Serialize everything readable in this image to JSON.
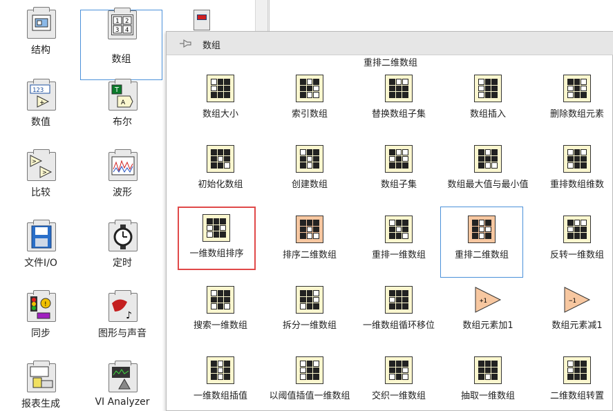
{
  "left_palette": {
    "items": [
      {
        "label": "结构",
        "icon": "structure-icon"
      },
      {
        "label": "数组",
        "icon": "array-icon",
        "glyph": "8 1 2\n3 4"
      },
      {
        "label": "数值",
        "icon": "numeric-icon",
        "glyph": "123"
      },
      {
        "label": "布尔",
        "icon": "boolean-icon",
        "glyph": "T"
      },
      {
        "label": "比较",
        "icon": "comparison-icon"
      },
      {
        "label": "波形",
        "icon": "waveform-icon"
      },
      {
        "label": "文件I/O",
        "icon": "file-io-icon"
      },
      {
        "label": "定时",
        "icon": "timing-icon"
      },
      {
        "label": "同步",
        "icon": "synchronization-icon"
      },
      {
        "label": "图形与声音",
        "icon": "graphics-sound-icon"
      },
      {
        "label": "报表生成",
        "icon": "report-generation-icon"
      },
      {
        "label": "VI Analyzer",
        "icon": "vi-analyzer-icon"
      }
    ]
  },
  "subpalette": {
    "title": "数组",
    "pin_icon": "pin-icon",
    "row0_label": "重排二维数组",
    "items": [
      {
        "label": "数组大小",
        "icon": "array-size-icon"
      },
      {
        "label": "索引数组",
        "icon": "index-array-icon"
      },
      {
        "label": "替换数组子集",
        "icon": "replace-array-subset-icon"
      },
      {
        "label": "数组插入",
        "icon": "insert-into-array-icon"
      },
      {
        "label": "删除数组元素",
        "icon": "delete-from-array-icon"
      },
      {
        "label": "初始化数组",
        "icon": "initialize-array-icon"
      },
      {
        "label": "创建数组",
        "icon": "build-array-icon"
      },
      {
        "label": "数组子集",
        "icon": "array-subset-icon"
      },
      {
        "label": "数组最大值与最小值",
        "icon": "array-max-min-icon"
      },
      {
        "label": "重排数组维数",
        "icon": "reshape-array-icon"
      },
      {
        "label": "一维数组排序",
        "icon": "sort-1d-array-icon"
      },
      {
        "label": "排序二维数组",
        "icon": "sort-2d-array-icon"
      },
      {
        "label": "重排一维数组",
        "icon": "shuffle-1d-array-icon"
      },
      {
        "label": "重排二维数组",
        "icon": "shuffle-2d-array-icon"
      },
      {
        "label": "反转一维数组",
        "icon": "reverse-1d-array-icon"
      },
      {
        "label": "搜索一维数组",
        "icon": "search-1d-array-icon"
      },
      {
        "label": "拆分一维数组",
        "icon": "split-1d-array-icon"
      },
      {
        "label": "一维数组循环移位",
        "icon": "rotate-1d-array-icon"
      },
      {
        "label": "数组元素加1",
        "icon": "increment-array-element-icon"
      },
      {
        "label": "数组元素减1",
        "icon": "decrement-array-element-icon"
      },
      {
        "label": "一维数组插值",
        "icon": "interpolate-1d-array-icon"
      },
      {
        "label": "以阈值插值一维数组",
        "icon": "threshold-1d-array-icon"
      },
      {
        "label": "交织一维数组",
        "icon": "interleave-1d-arrays-icon"
      },
      {
        "label": "抽取一维数组",
        "icon": "decimate-1d-array-icon"
      },
      {
        "label": "二维数组转置",
        "icon": "transpose-2d-array-icon"
      }
    ]
  },
  "colors": {
    "icon_yellow": "#fbf7cf",
    "icon_orange": "#f7c7a0",
    "highlight_red": "#e04848",
    "highlight_blue": "#4a90d9"
  }
}
